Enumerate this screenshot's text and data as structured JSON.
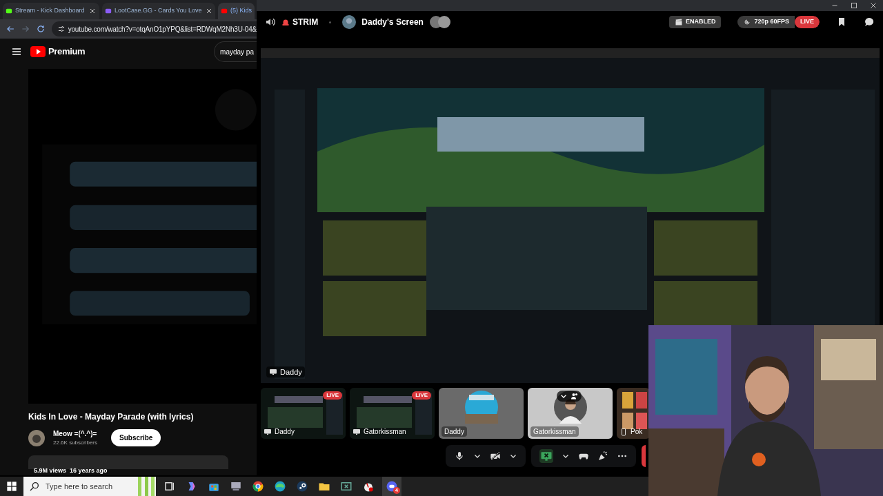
{
  "browser": {
    "tabs": [
      {
        "title": "Stream - Kick Dashboard",
        "selected": false
      },
      {
        "title": "LootCase.GG - Cards You Love",
        "selected": false
      },
      {
        "title": "(5) Kids",
        "selected": true
      }
    ],
    "url": "youtube.com/watch?v=otqAnO1pYPQ&list=RDWqM2Nh3U-04&",
    "youtube": {
      "logo": "Premium",
      "search": "mayday pa",
      "title": "Kids In Love - Mayday Parade (with lyrics)",
      "channel": "Meow =(^.^)=",
      "subscribers": "22.6K subscribers",
      "subscribe": "Subscribe",
      "stats": "5.9M views  16 years ago"
    }
  },
  "discord": {
    "channel": "STRIM",
    "stream_title": "Daddy's Screen",
    "enabled": "ENABLED",
    "quality": "720p 60FPS",
    "live": "LIVE",
    "stream": {
      "kind": "picture",
      "label": "Daddy"
    },
    "tiles": [
      {
        "kind": "screen",
        "label": "Daddy",
        "badge": "LIVE"
      },
      {
        "kind": "screen",
        "label": "Gatorkissman",
        "badge": "LIVE"
      },
      {
        "kind": "avatar",
        "label": "Daddy"
      },
      {
        "kind": "avatar",
        "label": "Gatorkissman"
      },
      {
        "kind": "phone",
        "label": "Pok"
      }
    ]
  },
  "taskbar": {
    "search_placeholder": "Type here to search",
    "discord_badge": "4"
  }
}
